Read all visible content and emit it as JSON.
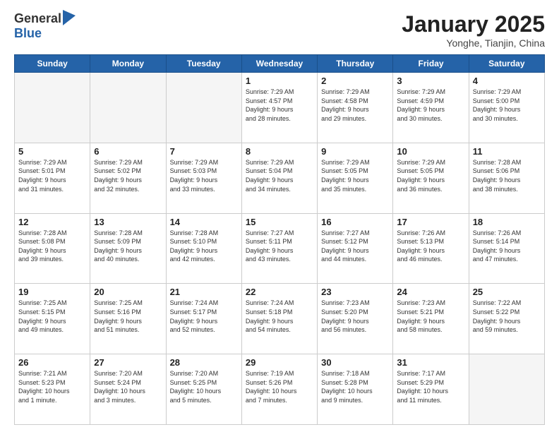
{
  "logo": {
    "general": "General",
    "blue": "Blue"
  },
  "title": {
    "month": "January 2025",
    "location": "Yonghe, Tianjin, China"
  },
  "weekdays": [
    "Sunday",
    "Monday",
    "Tuesday",
    "Wednesday",
    "Thursday",
    "Friday",
    "Saturday"
  ],
  "weeks": [
    [
      {
        "day": "",
        "info": ""
      },
      {
        "day": "",
        "info": ""
      },
      {
        "day": "",
        "info": ""
      },
      {
        "day": "1",
        "info": "Sunrise: 7:29 AM\nSunset: 4:57 PM\nDaylight: 9 hours\nand 28 minutes."
      },
      {
        "day": "2",
        "info": "Sunrise: 7:29 AM\nSunset: 4:58 PM\nDaylight: 9 hours\nand 29 minutes."
      },
      {
        "day": "3",
        "info": "Sunrise: 7:29 AM\nSunset: 4:59 PM\nDaylight: 9 hours\nand 30 minutes."
      },
      {
        "day": "4",
        "info": "Sunrise: 7:29 AM\nSunset: 5:00 PM\nDaylight: 9 hours\nand 30 minutes."
      }
    ],
    [
      {
        "day": "5",
        "info": "Sunrise: 7:29 AM\nSunset: 5:01 PM\nDaylight: 9 hours\nand 31 minutes."
      },
      {
        "day": "6",
        "info": "Sunrise: 7:29 AM\nSunset: 5:02 PM\nDaylight: 9 hours\nand 32 minutes."
      },
      {
        "day": "7",
        "info": "Sunrise: 7:29 AM\nSunset: 5:03 PM\nDaylight: 9 hours\nand 33 minutes."
      },
      {
        "day": "8",
        "info": "Sunrise: 7:29 AM\nSunset: 5:04 PM\nDaylight: 9 hours\nand 34 minutes."
      },
      {
        "day": "9",
        "info": "Sunrise: 7:29 AM\nSunset: 5:05 PM\nDaylight: 9 hours\nand 35 minutes."
      },
      {
        "day": "10",
        "info": "Sunrise: 7:29 AM\nSunset: 5:05 PM\nDaylight: 9 hours\nand 36 minutes."
      },
      {
        "day": "11",
        "info": "Sunrise: 7:28 AM\nSunset: 5:06 PM\nDaylight: 9 hours\nand 38 minutes."
      }
    ],
    [
      {
        "day": "12",
        "info": "Sunrise: 7:28 AM\nSunset: 5:08 PM\nDaylight: 9 hours\nand 39 minutes."
      },
      {
        "day": "13",
        "info": "Sunrise: 7:28 AM\nSunset: 5:09 PM\nDaylight: 9 hours\nand 40 minutes."
      },
      {
        "day": "14",
        "info": "Sunrise: 7:28 AM\nSunset: 5:10 PM\nDaylight: 9 hours\nand 42 minutes."
      },
      {
        "day": "15",
        "info": "Sunrise: 7:27 AM\nSunset: 5:11 PM\nDaylight: 9 hours\nand 43 minutes."
      },
      {
        "day": "16",
        "info": "Sunrise: 7:27 AM\nSunset: 5:12 PM\nDaylight: 9 hours\nand 44 minutes."
      },
      {
        "day": "17",
        "info": "Sunrise: 7:26 AM\nSunset: 5:13 PM\nDaylight: 9 hours\nand 46 minutes."
      },
      {
        "day": "18",
        "info": "Sunrise: 7:26 AM\nSunset: 5:14 PM\nDaylight: 9 hours\nand 47 minutes."
      }
    ],
    [
      {
        "day": "19",
        "info": "Sunrise: 7:25 AM\nSunset: 5:15 PM\nDaylight: 9 hours\nand 49 minutes."
      },
      {
        "day": "20",
        "info": "Sunrise: 7:25 AM\nSunset: 5:16 PM\nDaylight: 9 hours\nand 51 minutes."
      },
      {
        "day": "21",
        "info": "Sunrise: 7:24 AM\nSunset: 5:17 PM\nDaylight: 9 hours\nand 52 minutes."
      },
      {
        "day": "22",
        "info": "Sunrise: 7:24 AM\nSunset: 5:18 PM\nDaylight: 9 hours\nand 54 minutes."
      },
      {
        "day": "23",
        "info": "Sunrise: 7:23 AM\nSunset: 5:20 PM\nDaylight: 9 hours\nand 56 minutes."
      },
      {
        "day": "24",
        "info": "Sunrise: 7:23 AM\nSunset: 5:21 PM\nDaylight: 9 hours\nand 58 minutes."
      },
      {
        "day": "25",
        "info": "Sunrise: 7:22 AM\nSunset: 5:22 PM\nDaylight: 9 hours\nand 59 minutes."
      }
    ],
    [
      {
        "day": "26",
        "info": "Sunrise: 7:21 AM\nSunset: 5:23 PM\nDaylight: 10 hours\nand 1 minute."
      },
      {
        "day": "27",
        "info": "Sunrise: 7:20 AM\nSunset: 5:24 PM\nDaylight: 10 hours\nand 3 minutes."
      },
      {
        "day": "28",
        "info": "Sunrise: 7:20 AM\nSunset: 5:25 PM\nDaylight: 10 hours\nand 5 minutes."
      },
      {
        "day": "29",
        "info": "Sunrise: 7:19 AM\nSunset: 5:26 PM\nDaylight: 10 hours\nand 7 minutes."
      },
      {
        "day": "30",
        "info": "Sunrise: 7:18 AM\nSunset: 5:28 PM\nDaylight: 10 hours\nand 9 minutes."
      },
      {
        "day": "31",
        "info": "Sunrise: 7:17 AM\nSunset: 5:29 PM\nDaylight: 10 hours\nand 11 minutes."
      },
      {
        "day": "",
        "info": ""
      }
    ]
  ]
}
